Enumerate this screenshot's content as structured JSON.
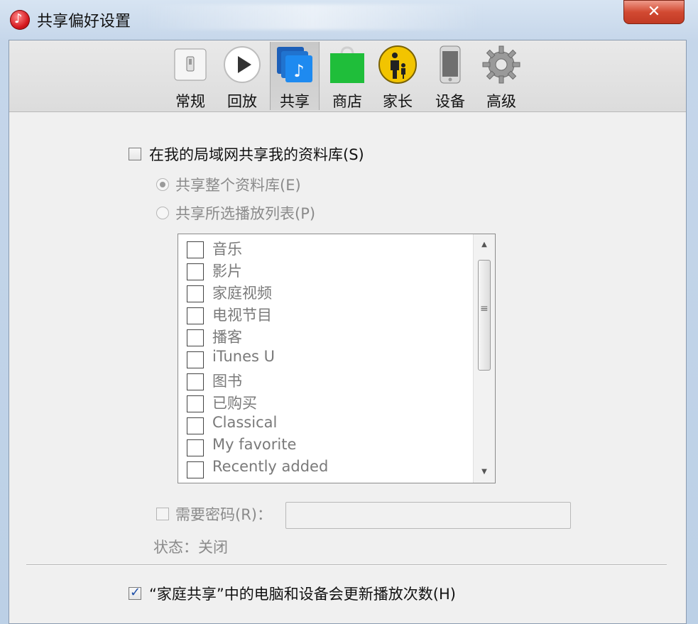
{
  "window": {
    "title": "共享偏好设置",
    "close_label": "✕"
  },
  "toolbar": {
    "tabs": [
      {
        "label": "常规",
        "icon": "general-switch-icon"
      },
      {
        "label": "回放",
        "icon": "play-icon"
      },
      {
        "label": "共享",
        "icon": "sharing-icon",
        "selected": true
      },
      {
        "label": "商店",
        "icon": "store-bag-icon"
      },
      {
        "label": "家长",
        "icon": "parental-icon"
      },
      {
        "label": "设备",
        "icon": "device-phone-icon"
      },
      {
        "label": "高级",
        "icon": "gear-icon"
      }
    ]
  },
  "sharing": {
    "share_library_label": "在我的局域网共享我的资料库(S)",
    "share_library_checked": false,
    "share_entire_label": "共享整个资料库(E)",
    "share_entire_selected": true,
    "share_selected_label": "共享所选播放列表(P)",
    "share_selected_selected": false,
    "playlists": [
      "音乐",
      "影片",
      "家庭视频",
      "电视节目",
      "播客",
      "iTunes U",
      "图书",
      "已购买",
      "Classical",
      "My favorite",
      "Recently added"
    ],
    "require_password_label": "需要密码(R)：",
    "require_password_checked": false,
    "password_value": "",
    "status_text": "状态：关闭",
    "home_sharing_label": "“家庭共享”中的电脑和设备会更新播放次数(H)",
    "home_sharing_checked": true
  },
  "colors": {
    "title_bar": "#c5d6ea",
    "close_button": "#d24a32",
    "checkbox_check": "#1f4fa8",
    "sharing_icon": "#1e7fe0",
    "store_icon": "#22b14c",
    "parental_icon": "#f2c400"
  }
}
